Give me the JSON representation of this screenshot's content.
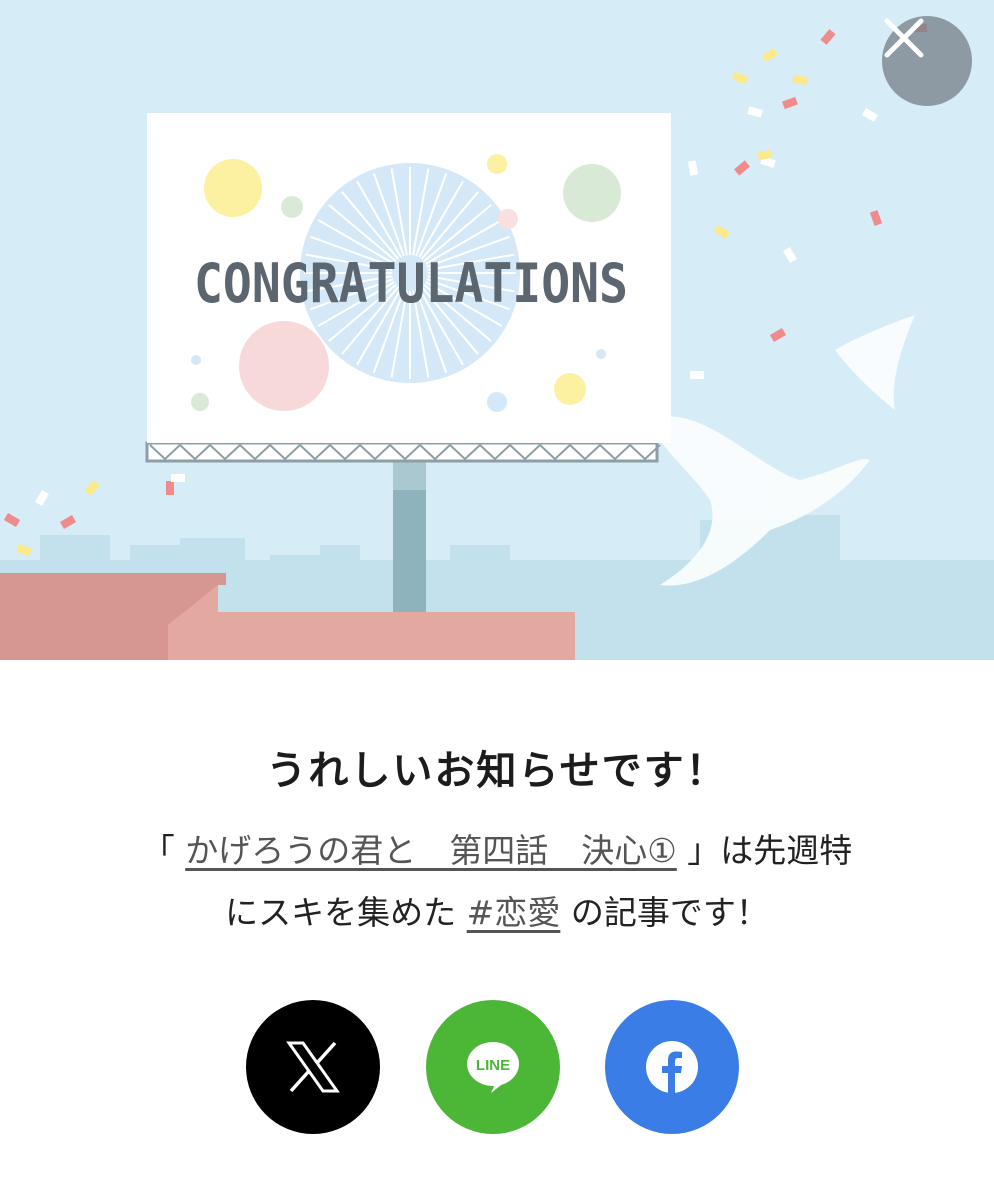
{
  "colors": {
    "sky": "#d6ecf7",
    "x_brand": "#000000",
    "line_brand": "#4cb636",
    "facebook_brand": "#3b7de6",
    "close_bg": "#7d8790"
  },
  "illustration": {
    "billboard_text": "CONGRATULATIONS"
  },
  "close_button": {
    "icon": "close-icon"
  },
  "notice": {
    "title": "うれしいお知らせです！",
    "open_bracket": "「",
    "article_title": "かげろうの君と　第四話　決心①",
    "close_bracket_text": "」は先週特",
    "line2_prefix": "にスキを集めた",
    "hashtag": "#恋愛",
    "line2_suffix": "の記事です！"
  },
  "share": {
    "x": {
      "icon": "x-logo-icon"
    },
    "line": {
      "icon": "line-logo-icon",
      "label": "LINE"
    },
    "facebook": {
      "icon": "facebook-logo-icon"
    }
  }
}
